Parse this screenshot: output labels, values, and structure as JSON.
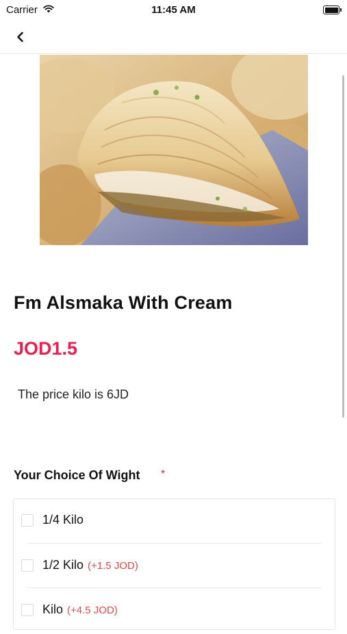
{
  "status_bar": {
    "carrier": "Carrier",
    "time": "11:45 AM"
  },
  "nav": {
    "back_icon": "chevron-left-icon"
  },
  "product": {
    "title": "Fm Alsmaka With Cream",
    "price": "JOD1.5",
    "description": "The price kilo is 6JD"
  },
  "options_section": {
    "title": "Your Choice Of Wight",
    "required_mark": "*",
    "options": [
      {
        "label": "1/4 Kilo",
        "extra": ""
      },
      {
        "label": "1/2 Kilo",
        "extra": "(+1.5 JOD)"
      },
      {
        "label": "Kilo",
        "extra": "(+4.5 JOD)"
      }
    ]
  },
  "colors": {
    "price": "#e8204f",
    "required": "#e8204f",
    "extra_price": "#e04848"
  }
}
